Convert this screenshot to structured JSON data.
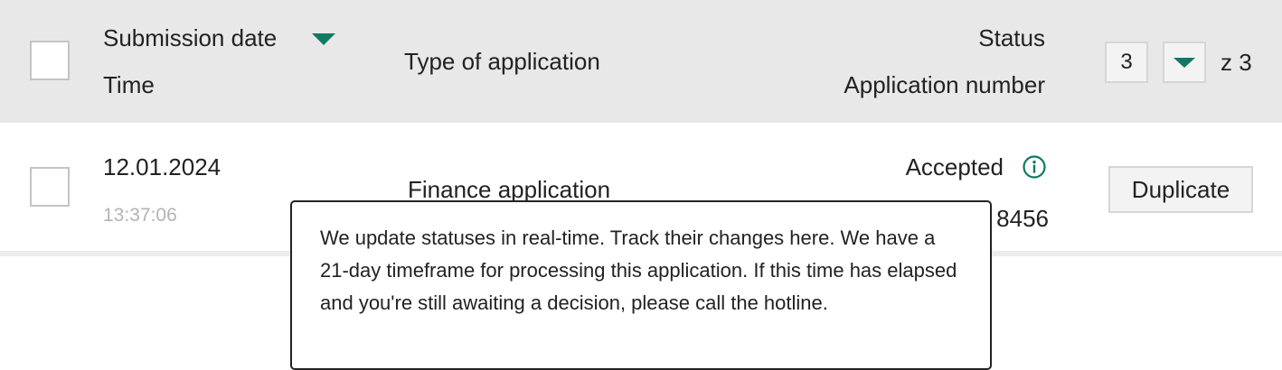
{
  "table": {
    "header": {
      "date_label": "Submission date",
      "time_label": "Time",
      "type_label": "Type of application",
      "status_label": "Status",
      "appnum_label": "Application number",
      "sort_icon": "caret-down-icon"
    },
    "pagination": {
      "current_page": "3",
      "total_label": "z 3",
      "dropdown_icon": "caret-down-icon"
    },
    "rows": [
      {
        "date": "12.01.2024",
        "time": "13:37:06",
        "type": "Finance application",
        "status": "Accepted",
        "status_icon": "info-icon",
        "appnum_visible": "8456",
        "action_label": "Duplicate"
      }
    ]
  },
  "tooltip": {
    "text": "We update statuses in real-time. Track their changes here. We have a 21-day timeframe for processing this application. If this time has elapsed and you're still awaiting a decision, please call the hotline."
  },
  "colors": {
    "accent": "#0f7a62",
    "header_bg": "#e8e8e8",
    "muted_text": "#b3b3b3"
  }
}
